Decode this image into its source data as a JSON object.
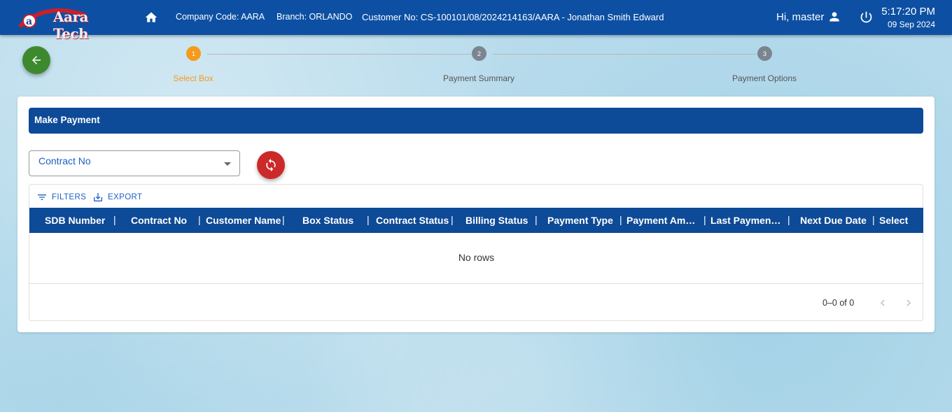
{
  "header": {
    "logo_text": "Aara Tech",
    "company_code": "Company Code: AARA",
    "branch": "Branch: ORLANDO",
    "customer": "Customer No: CS-100101/08/2024214163/AARA - Jonathan Smith Edward",
    "greeting": "Hi, master",
    "time": "5:17:20 PM",
    "date": "09 Sep 2024"
  },
  "stepper": {
    "steps": [
      {
        "number": "1",
        "label": "Select Box",
        "state": "active"
      },
      {
        "number": "2",
        "label": "Payment Summary",
        "state": "inactive"
      },
      {
        "number": "3",
        "label": "Payment Options",
        "state": "inactive"
      }
    ]
  },
  "card": {
    "title": "Make Payment",
    "contract_select_label": "Contract No"
  },
  "grid": {
    "toolbar": {
      "filters_label": "FILTERS",
      "export_label": "EXPORT"
    },
    "columns": [
      "SDB Number",
      "Contract No",
      "Customer Name",
      "Box Status",
      "Contract Status",
      "Billing Status",
      "Payment Type",
      "Payment Amo...",
      "Last Payment ...",
      "Next Due Date",
      "Select"
    ],
    "empty_message": "No rows",
    "pagination": "0–0 of 0"
  },
  "colors": {
    "header_bg": "#0d50a3",
    "table_header_bg": "#0d4a97",
    "active_step": "#f59a1b",
    "inactive_step": "#7a8590",
    "back_button": "#3d8a2e",
    "refresh_button": "#cc2a2a",
    "link_blue": "#1d5fc4"
  }
}
